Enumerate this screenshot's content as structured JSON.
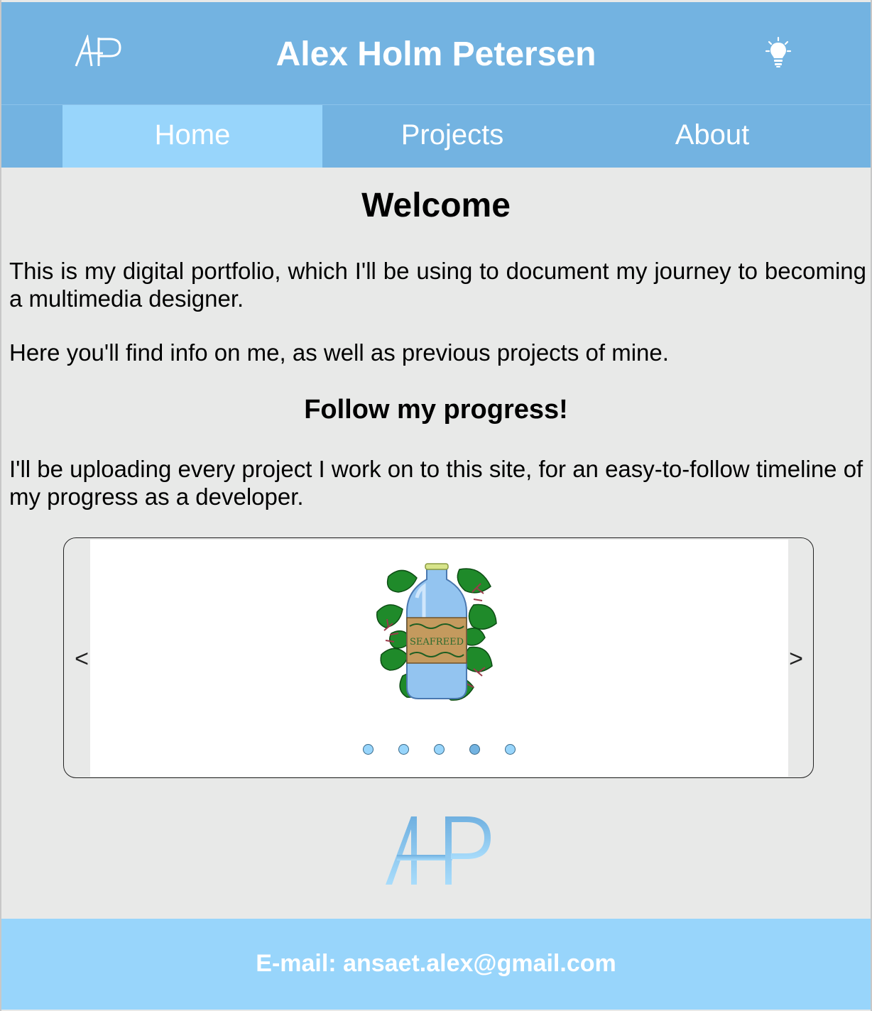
{
  "header": {
    "logo_text": "AHP",
    "title": "Alex Holm Petersen",
    "theme_toggle_icon": "lightbulb-icon"
  },
  "nav": {
    "items": [
      {
        "label": "Home",
        "active": true
      },
      {
        "label": "Projects",
        "active": false
      },
      {
        "label": "About",
        "active": false
      }
    ]
  },
  "main": {
    "heading": "Welcome",
    "intro_1": "This is my digital portfolio, which I'll be using to document my journey to becoming a multimedia designer.",
    "intro_2": "Here you'll find info on me, as well as previous projects of mine.",
    "subheading": "Follow my progress!",
    "intro_3": "I'll be uploading every project I work on to this site, for an easy-to-follow timeline of my progress as a developer."
  },
  "carousel": {
    "prev_icon": "chevron-left-icon",
    "next_icon": "chevron-right-icon",
    "prev_glyph": "<",
    "next_glyph": ">",
    "slide_label": "SEAFREED",
    "dot_count": 5,
    "active_dot": 3
  },
  "colors": {
    "header_blue": "#73b3e1",
    "light_blue": "#98d5fb",
    "background": "#e8e9e8"
  },
  "footer": {
    "email": "E-mail: ansaet.alex@gmail.com"
  }
}
